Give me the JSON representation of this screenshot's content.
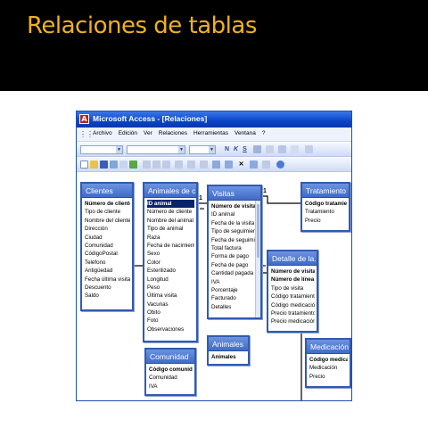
{
  "slide": {
    "title": "Relaciones de tablas"
  },
  "window": {
    "title": "Microsoft Access - [Relaciones]"
  },
  "menu": [
    "Archivo",
    "Edición",
    "Ver",
    "Relaciones",
    "Herramientas",
    "Ventana",
    "?"
  ],
  "toolbar": {
    "bold": "N",
    "italic": "K",
    "underline": "S"
  },
  "tables": {
    "clientes": {
      "title": "Clientes",
      "fields": [
        "Número de cliente",
        "Tipo de cliente",
        "Nombre del cliente",
        "Dirección",
        "Ciudad",
        "Comunidad",
        "CódigoPostal",
        "Teléfono",
        "Antigüedad",
        "Fecha última visita",
        "Descuento",
        "Saldo"
      ]
    },
    "animales_de_c": {
      "title": "Animales de c...",
      "fields": [
        "ID animal",
        "Número de cliente",
        "Nombre del animal",
        "Tipo de animal",
        "Raza",
        "Fecha de nacimiento",
        "Sexo",
        "Color",
        "Esterilizado",
        "Longitud",
        "Peso",
        "Última visita",
        "Vacunas",
        "Obito",
        "Foto",
        "Observaciones"
      ]
    },
    "visitas": {
      "title": "Visitas",
      "fields": [
        "Número de visita",
        "ID animal",
        "Fecha de la visita",
        "Tipo de seguimiento",
        "Fecha de seguimiento",
        "Total factura",
        "Forma de pago",
        "Fecha de pago",
        "Cantidad pagada",
        "IVA",
        "Porcentaje",
        "Facturado",
        "Detalles"
      ]
    },
    "tratamiento": {
      "title": "Tratamiento",
      "fields": [
        "Código tratamiento",
        "Tratamiento",
        "Precio"
      ]
    },
    "detalle": {
      "title": "Detalle de la...",
      "fields": [
        "Número de visita",
        "Número de línea",
        "Tipo de visita",
        "Código tratamiento",
        "Código medicación",
        "Precio tratamiento",
        "Precio medicación"
      ]
    },
    "animales": {
      "title": "Animales",
      "fields": [
        "Animales"
      ]
    },
    "comunidad": {
      "title": "Comunidad",
      "fields": [
        "Código comunidad",
        "Comunidad",
        "IVA"
      ]
    },
    "medicacion": {
      "title": "Medicación",
      "fields": [
        "Código medicación",
        "Medicación",
        "Precio"
      ]
    }
  },
  "relations": {
    "one": "1",
    "many": "∞"
  },
  "colors": {
    "banner": "#000000",
    "title": "#f0b21b",
    "table_header": "#4a74cf",
    "selected": "#0a246a"
  }
}
